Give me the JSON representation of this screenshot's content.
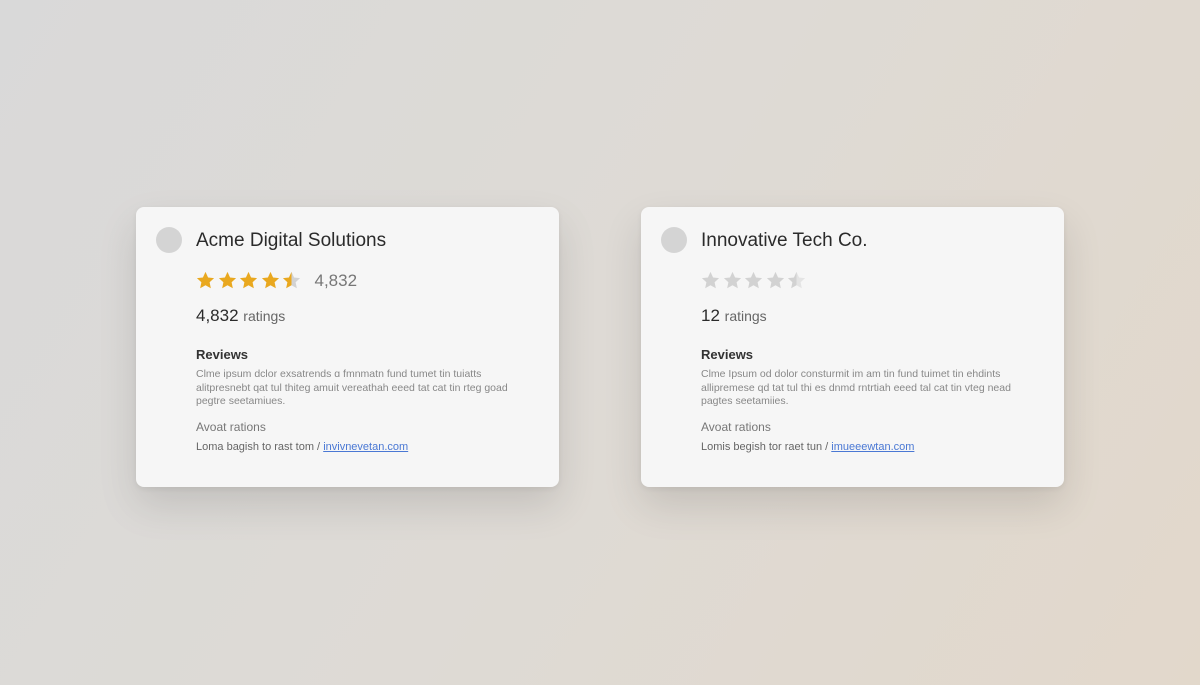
{
  "colors": {
    "star_filled": "#e9a81f",
    "star_empty": "#d2d2d2",
    "link": "#4a78d4"
  },
  "cards": [
    {
      "title": "Acme Digital Solutions",
      "star_rating": 4.5,
      "star_color": "#e9a81f",
      "star_count_text": "4,832",
      "ratings_number": "4,832",
      "ratings_label": "ratings",
      "reviews_heading": "Reviews",
      "review_lines": [
        "Clme ipsum dclor exsatrends ɑ fmnmatn fund tumet tin tuiatts",
        "alitpresnebt qat tul thiteg amuit vereathah eeed tat cat tin rteg goad",
        "pegtre seetamiues."
      ],
      "sub_heading": "Avoat rations",
      "source_text": "Loma bagish to rast tom /",
      "source_link": "invivnevetan.com"
    },
    {
      "title": "Innovative Tech Co.",
      "star_rating": 4.5,
      "star_color": "#d2d2d2",
      "star_count_text": "",
      "ratings_number": "12",
      "ratings_label": "ratings",
      "reviews_heading": "Reviews",
      "review_lines": [
        "Clme Ipsum od dolor consturmit im am tin fund tuimet tin ehdints",
        "allipremese qd tat tul thi es dnmd rntrtiah eeed tal cat tin vteg nead",
        "pagtes seetamiies."
      ],
      "sub_heading": "Avoat rations",
      "source_text": "Lomis begish tor raet tun /",
      "source_link": "imueeewtan.com"
    }
  ]
}
